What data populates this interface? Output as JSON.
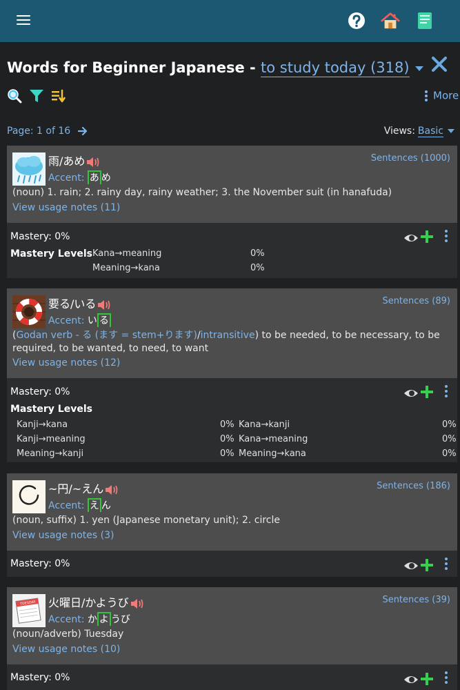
{
  "header": {
    "menu": "menu-icon",
    "help": "help-icon",
    "home": "home-icon",
    "book": "book-icon",
    "bg": "#1d5873"
  },
  "title": {
    "prefix": "Words for Beginner Japanese - ",
    "filter": "to study today (318)"
  },
  "toolbar": {
    "more": "More"
  },
  "pager": {
    "text": "Page: 1 of 16"
  },
  "views": {
    "label": "Views:",
    "value": "Basic"
  },
  "cards": [
    {
      "word": "雨/あめ",
      "sentences": "Sentences (1000)",
      "accent_label": "Accent:",
      "accent_pre": "",
      "accent_hl": "あ",
      "accent_post": "め",
      "meaning": "(noun) 1. rain; 2. rainy day, rainy weather; 3. the November suit (in hanafuda)",
      "usage": "View usage notes (11)",
      "mastery": "Mastery: 0%",
      "levels_title": "Mastery Levels",
      "levels": [
        {
          "label": "Kana→meaning",
          "value": "0%"
        },
        {
          "label": "Meaning→kana",
          "value": "0%"
        }
      ]
    },
    {
      "word": "要る/いる",
      "sentences": "Sentences (89)",
      "accent_label": "Accent:",
      "accent_pre": "い",
      "accent_hl": "る",
      "accent_post": "",
      "meaning_open": "(",
      "meaning_tag1": "Godan verb - る (ます = stem+ります)",
      "meaning_sep": "/",
      "meaning_tag2": "intransitive",
      "meaning_rest": ") to be needed, to be necessary, to be required, to be wanted, to need, to want",
      "usage": "View usage notes (12)",
      "mastery": "Mastery: 0%",
      "levels_title": "Mastery Levels",
      "levels": [
        {
          "label": "Kanji→kana",
          "value": "0%"
        },
        {
          "label": "Kana→kanji",
          "value": "0%"
        },
        {
          "label": "Kanji→meaning",
          "value": "0%"
        },
        {
          "label": "Kana→meaning",
          "value": "0%"
        },
        {
          "label": "Meaning→kanji",
          "value": "0%"
        },
        {
          "label": "Meaning→kana",
          "value": "0%"
        }
      ]
    },
    {
      "word": "~円/~えん",
      "sentences": "Sentences (186)",
      "accent_label": "Accent:",
      "accent_pre": "",
      "accent_hl": "え",
      "accent_post": "ん",
      "meaning": "(noun, suffix) 1. yen (Japanese monetary unit); 2. circle",
      "usage": "View usage notes (3)",
      "mastery": "Mastery: 0%"
    },
    {
      "word": "火曜日/かようび",
      "sentences": "Sentences (39)",
      "accent_label": "Accent:",
      "accent_pre": "か",
      "accent_hl": "よ",
      "accent_post": "うび",
      "meaning": "(noun/adverb) Tuesday",
      "usage": "View usage notes (10)",
      "mastery": "Mastery: 0%",
      "thumb_text": "TUESDAY"
    }
  ]
}
